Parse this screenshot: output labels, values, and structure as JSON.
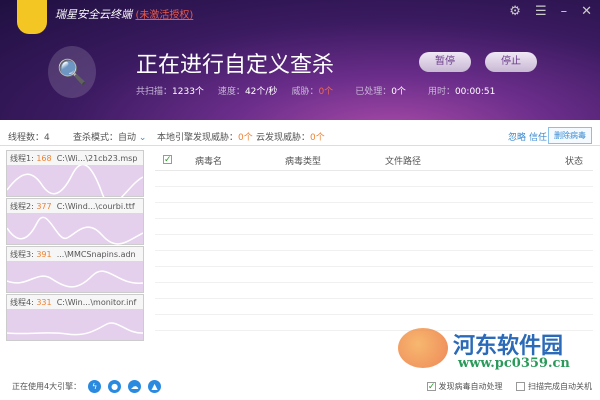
{
  "app": {
    "title": "瑞星安全云终端",
    "unactivated": "(未激活授权)"
  },
  "window_icons": [
    "gear-icon",
    "menu-icon",
    "minimize-icon",
    "close-icon"
  ],
  "scan": {
    "title": "正在进行自定义查杀",
    "pause": "暂停",
    "stop": "停止",
    "stats": [
      {
        "label": "共扫描：",
        "value": "1233个"
      },
      {
        "label": "速度：",
        "value": "42个/秒"
      },
      {
        "label": "威胁：",
        "value": "0个"
      },
      {
        "label": "已处理：",
        "value": "0个"
      },
      {
        "label": "用时：",
        "value": "00:00:51"
      }
    ]
  },
  "toolbar": {
    "threads": "线程数：4",
    "mode": "查杀模式：自动",
    "local_label": "本地引擎发现威胁：",
    "local_value": "0个",
    "cloud_label": "云发现威胁：",
    "cloud_value": "0个",
    "ignore": "忽略",
    "trust": "信任",
    "delete": "删除病毒"
  },
  "threads": [
    {
      "label": "线程1:",
      "count": "168",
      "path": "C:\\Wi...\\21cb23.msp"
    },
    {
      "label": "线程2:",
      "count": "377",
      "path": "C:\\Wind...\\courbi.ttf"
    },
    {
      "label": "线程3:",
      "count": "391",
      "path": "...\\MMCSnapins.adn"
    },
    {
      "label": "线程4:",
      "count": "331",
      "path": "C:\\Win...\\monitor.inf"
    }
  ],
  "table": {
    "columns": [
      "病毒名",
      "病毒类型",
      "文件路径",
      "状态"
    ]
  },
  "footer": {
    "engines_label": "正在使用4大引擎：",
    "auto_handle": "发现病毒自动处理",
    "auto_shutdown": "扫描完成自动关机"
  },
  "watermark": {
    "name": "河东软件园",
    "url": "www.pc0359.cn"
  }
}
